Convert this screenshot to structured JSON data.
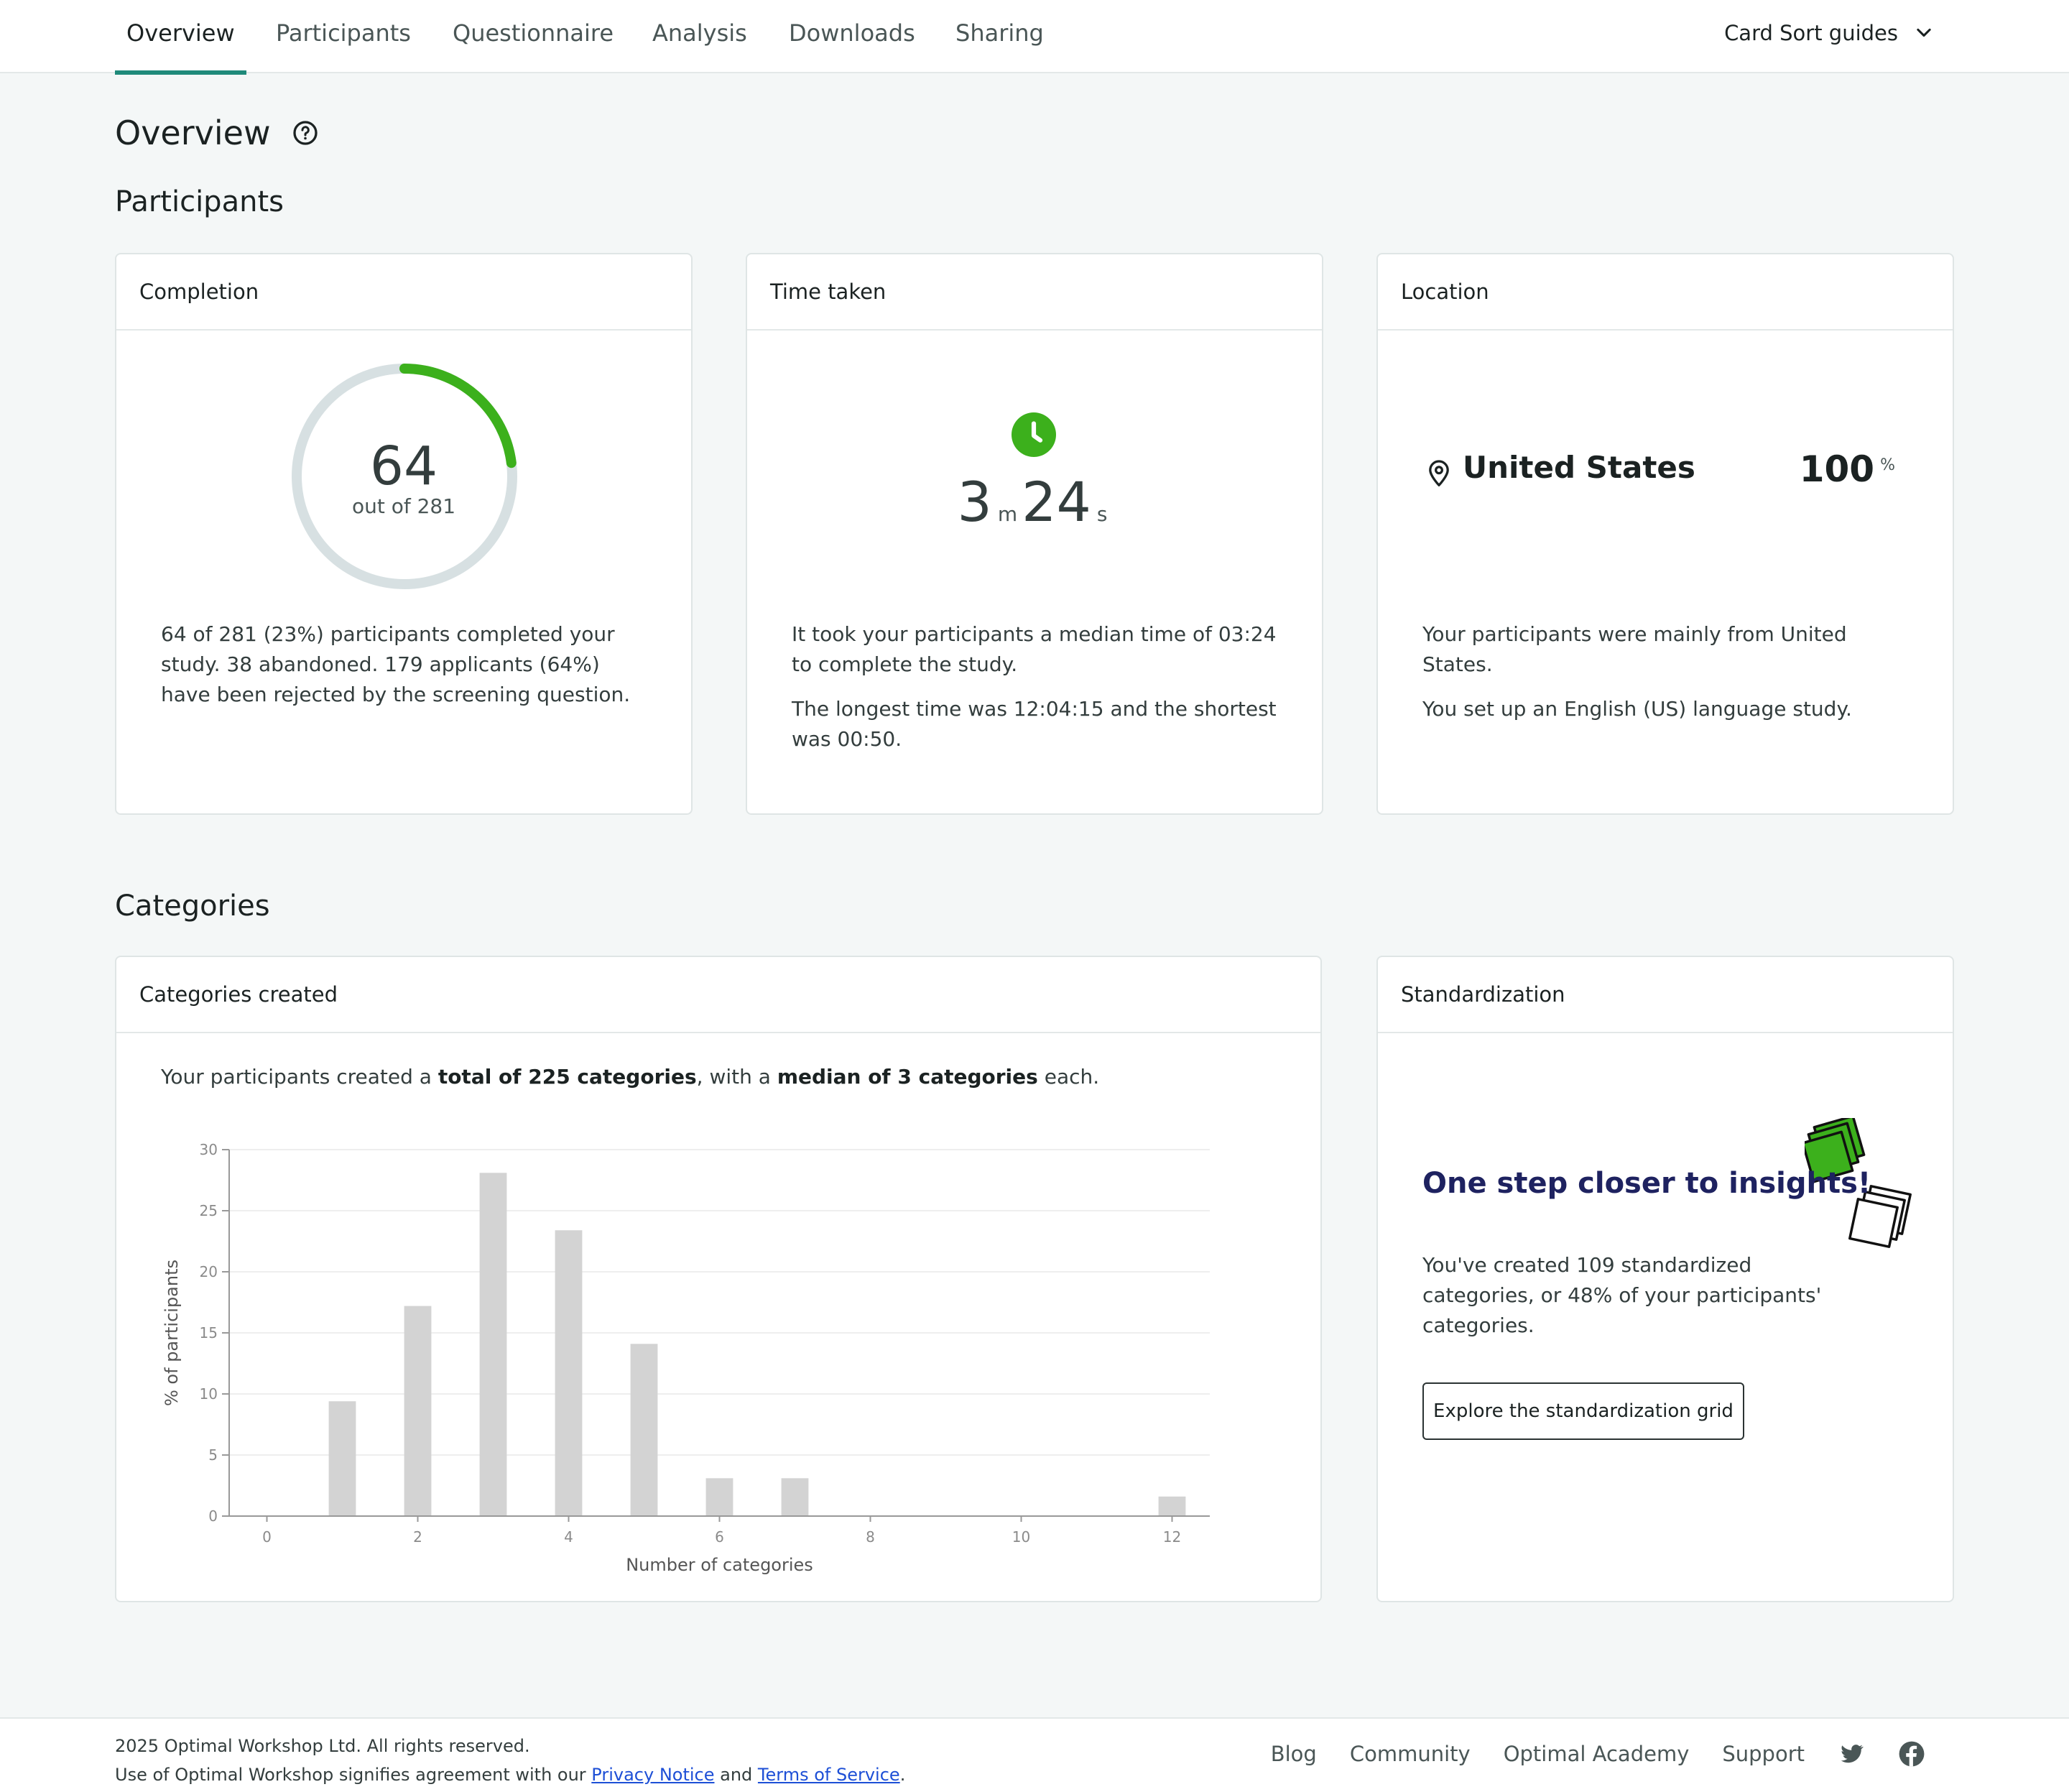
{
  "nav": {
    "tabs": [
      {
        "label": "Overview",
        "active": true
      },
      {
        "label": "Participants"
      },
      {
        "label": "Questionnaire"
      },
      {
        "label": "Analysis"
      },
      {
        "label": "Downloads"
      },
      {
        "label": "Sharing"
      }
    ],
    "guides_label": "Card Sort guides",
    "guides_icon": "chevron-down-icon"
  },
  "page": {
    "title": "Overview",
    "help_icon": "help-circle-icon"
  },
  "participants": {
    "heading": "Participants",
    "completion": {
      "title": "Completion",
      "completed": "64",
      "out_of": "out of 281",
      "fraction": 0.23,
      "text": "64 of 281 (23%) participants completed your study. 38 abandoned. 179 applicants (64%) have been rejected by the screening question."
    },
    "time_taken": {
      "title": "Time taken",
      "minutes": "3",
      "minutes_unit": "m",
      "seconds": "24",
      "seconds_unit": "s",
      "icon": "clock-icon",
      "text1": "It took your participants a median time of 03:24 to complete the study.",
      "text2": "The longest time was 12:04:15 and the shortest was 00:50."
    },
    "location": {
      "title": "Location",
      "country": "United States",
      "percent": "100",
      "percent_sign": "%",
      "icon": "location-pin-icon",
      "text1": "Your participants were mainly from United States.",
      "text2": "You set up an English (US) language study."
    }
  },
  "categories": {
    "heading": "Categories",
    "created": {
      "title": "Categories created",
      "summary_prefix": "Your participants created a ",
      "summary_total": "total of 225 categories",
      "summary_mid": ", with a ",
      "summary_median": "median of 3 categories",
      "summary_suffix": " each."
    },
    "standardization": {
      "title": "Standardization",
      "headline": "One step closer to insights!",
      "text": "You've created 109 standardized categories, or 48% of your participants' categories.",
      "button_label": "Explore the standardization grid",
      "illustration": "stacked-cards-icon"
    }
  },
  "chart_data": {
    "type": "bar",
    "x": [
      1,
      2,
      3,
      4,
      5,
      6,
      7,
      12
    ],
    "values": [
      9.4,
      17.2,
      28.1,
      23.4,
      14.1,
      3.1,
      3.1,
      1.6
    ],
    "xlabel": "Number of categories",
    "ylabel": "% of participants",
    "xlim": [
      -0.5,
      12.5
    ],
    "ylim": [
      0,
      30
    ],
    "xticks": [
      0,
      2,
      4,
      6,
      8,
      10,
      12
    ],
    "yticks": [
      0,
      5,
      10,
      15,
      20,
      25,
      30
    ],
    "bar_color": "#d3d3d3",
    "grid": true
  },
  "footer": {
    "copyright": "2025 Optimal Workshop Ltd. All rights reserved.",
    "terms_prefix": "Use of Optimal Workshop signifies agreement with our ",
    "privacy_label": "Privacy Notice",
    "and": " and ",
    "terms_label": "Terms of Service",
    "period": ".",
    "links": [
      "Blog",
      "Community",
      "Optimal Academy",
      "Support"
    ],
    "social_icons": [
      "twitter-icon",
      "facebook-icon"
    ]
  },
  "colors": {
    "accent": "#1f8a7a",
    "success_green": "#3cb01c",
    "donut_track": "#d7e0e2",
    "headline_navy": "#1e2260"
  }
}
